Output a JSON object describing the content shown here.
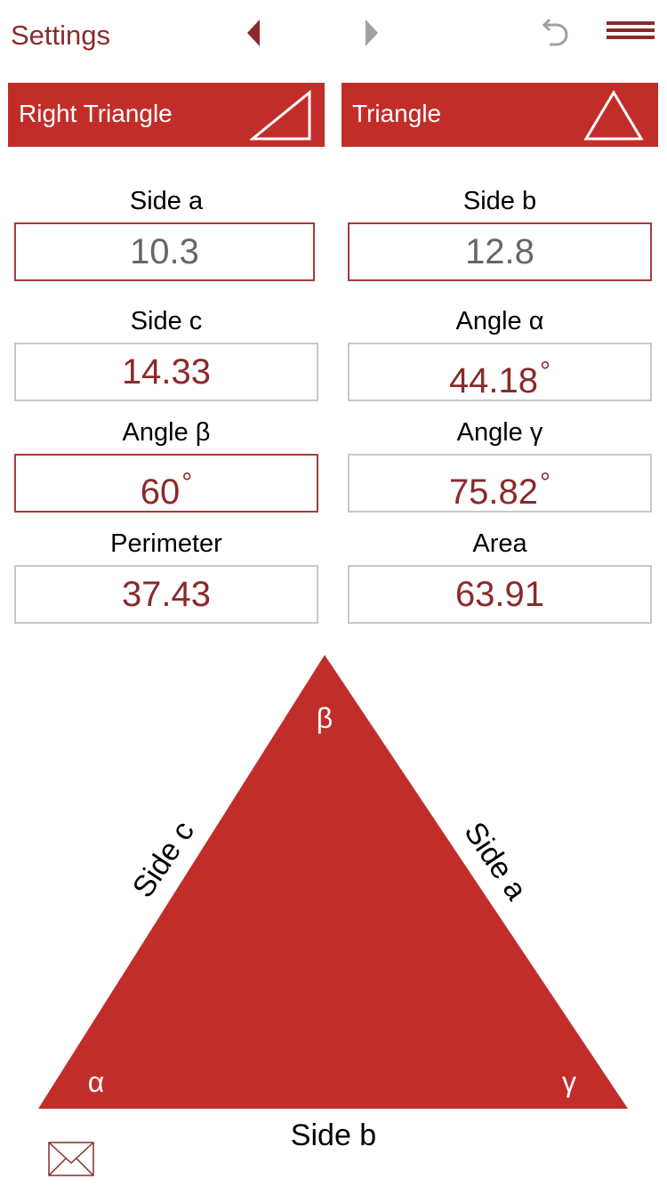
{
  "header": {
    "settings_label": "Settings",
    "prev_icon": "triangle-left-icon",
    "next_icon": "triangle-right-icon",
    "undo_icon": "undo-icon",
    "menu_icon": "menu-icon"
  },
  "tabs": [
    {
      "label": "Right Triangle",
      "icon": "right-triangle-icon"
    },
    {
      "label": "Triangle",
      "icon": "triangle-icon"
    }
  ],
  "fields": {
    "side_a": {
      "label": "Side a",
      "value": "10.3"
    },
    "side_b": {
      "label": "Side b",
      "value": "12.8"
    },
    "side_c": {
      "label": "Side c",
      "value": "14.33"
    },
    "angle_alpha": {
      "label": "Angle α",
      "value": "44.18",
      "unit": "°"
    },
    "angle_beta": {
      "label": "Angle β",
      "value": "60",
      "unit": "°"
    },
    "angle_gamma": {
      "label": "Angle γ",
      "value": "75.82",
      "unit": "°"
    },
    "perimeter": {
      "label": "Perimeter",
      "value": "37.43"
    },
    "area": {
      "label": "Area",
      "value": "63.91"
    }
  },
  "diagram": {
    "vertex_alpha": "α",
    "vertex_beta": "β",
    "vertex_gamma": "γ",
    "side_a_label": "Side a",
    "side_b_label": "Side b",
    "side_c_label": "Side c",
    "fill_color": "#c12e2a"
  },
  "footer": {
    "mail_icon": "mail-icon"
  },
  "colors": {
    "accent": "#c12e2a",
    "text_accent": "#8b2a2a",
    "inactive": "#a0a0a0"
  }
}
